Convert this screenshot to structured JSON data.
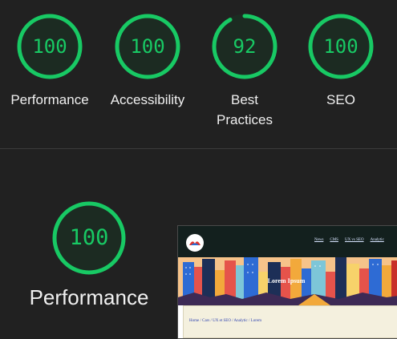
{
  "score_color": "#18c964",
  "gauges": [
    {
      "score": "100",
      "label": "Performance",
      "value": 100
    },
    {
      "score": "100",
      "label": "Accessibility",
      "value": 100
    },
    {
      "score": "92",
      "label_line1": "Best",
      "label_line2": "Practices",
      "value": 92
    },
    {
      "score": "100",
      "label": "SEO",
      "value": 100
    }
  ],
  "section": {
    "score": "100",
    "label": "Performance",
    "value": 100
  },
  "screenshot": {
    "hero_title": "Lorem Ipsum",
    "nav_links": [
      "News",
      "CMS",
      "UX vs SEO",
      "Analytic"
    ],
    "breadcrumb": "Home / Cars / UX et SEO / Analytic / Lorem"
  }
}
